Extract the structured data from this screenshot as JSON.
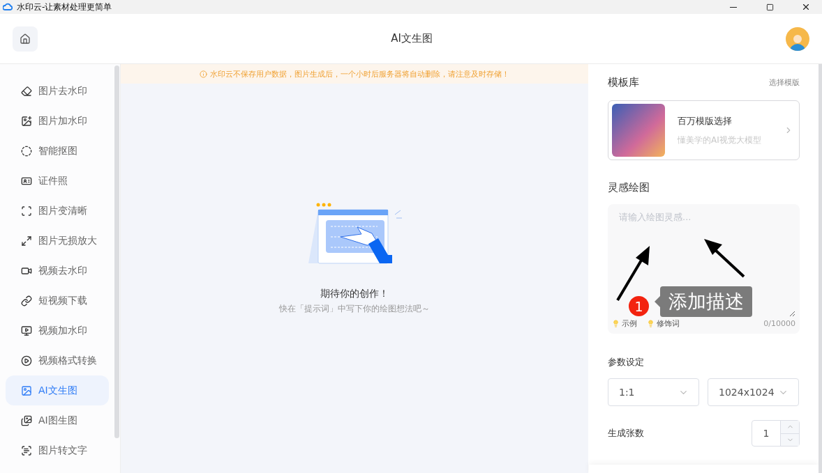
{
  "window": {
    "title": "水印云-让素材处理更简单"
  },
  "header": {
    "title": "AI文生图"
  },
  "sidebar": {
    "items": [
      {
        "label": "图片去水印",
        "selected": false
      },
      {
        "label": "图片加水印",
        "selected": false
      },
      {
        "label": "智能抠图",
        "selected": false
      },
      {
        "label": "证件照",
        "selected": false
      },
      {
        "label": "图片变清晰",
        "selected": false
      },
      {
        "label": "图片无损放大",
        "selected": false
      },
      {
        "label": "视频去水印",
        "selected": false
      },
      {
        "label": "短视频下载",
        "selected": false
      },
      {
        "label": "视频加水印",
        "selected": false
      },
      {
        "label": "视频格式转换",
        "selected": false
      },
      {
        "label": "AI文生图",
        "selected": true
      },
      {
        "label": "AI图生图",
        "selected": false
      },
      {
        "label": "图片转文字",
        "selected": false
      }
    ]
  },
  "notice": "水印云不保存用户数据，图片生成后，一个小时后服务器将自动删除，请注意及时存储！",
  "empty_state": {
    "title": "期待你的创作！",
    "subtitle": "快在「提示词」中写下你的绘图想法吧～"
  },
  "template_library": {
    "title": "模板库",
    "link": "选择模版",
    "card": {
      "title": "百万模版选择",
      "subtitle": "懂美学的AI视觉大模型"
    }
  },
  "inspiration": {
    "title": "灵感绘图",
    "placeholder": "请输入绘图灵感...",
    "chips": [
      "示例",
      "修饰词"
    ],
    "count": "0/10000",
    "annotation": {
      "badge": "1",
      "tooltip": "添加描述"
    }
  },
  "params": {
    "title": "参数设定",
    "ratio": "1:1",
    "size": "1024x1024",
    "count_label": "生成张数",
    "count": "1"
  }
}
